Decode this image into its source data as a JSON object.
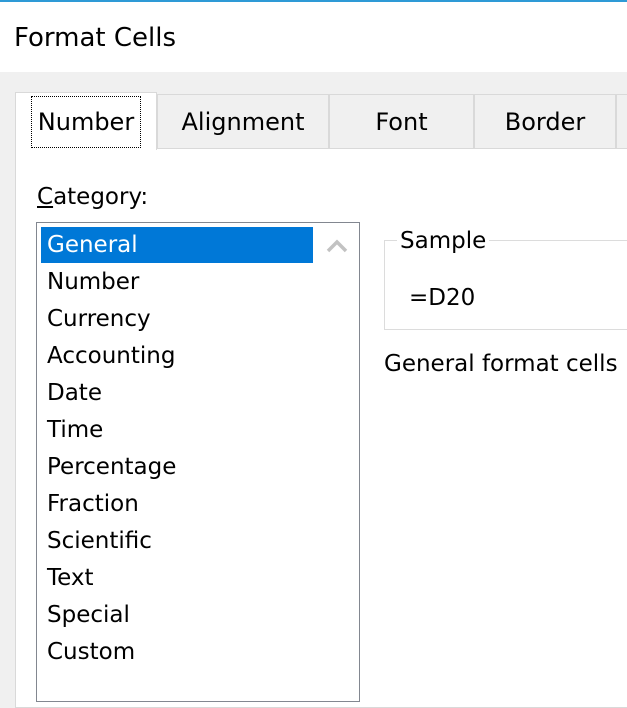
{
  "window": {
    "title": "Format Cells"
  },
  "tabs": [
    {
      "label": "Number",
      "active": true
    },
    {
      "label": "Alignment",
      "active": false
    },
    {
      "label": "Font",
      "active": false
    },
    {
      "label": "Border",
      "active": false
    }
  ],
  "number_tab": {
    "category_label_accel": "C",
    "category_label_rest": "ategory:",
    "categories": [
      {
        "label": "General",
        "selected": true
      },
      {
        "label": "Number",
        "selected": false
      },
      {
        "label": "Currency",
        "selected": false
      },
      {
        "label": "Accounting",
        "selected": false
      },
      {
        "label": "Date",
        "selected": false
      },
      {
        "label": "Time",
        "selected": false
      },
      {
        "label": "Percentage",
        "selected": false
      },
      {
        "label": "Fraction",
        "selected": false
      },
      {
        "label": "Scientific",
        "selected": false
      },
      {
        "label": "Text",
        "selected": false
      },
      {
        "label": "Special",
        "selected": false
      },
      {
        "label": "Custom",
        "selected": false
      }
    ],
    "sample": {
      "legend": "Sample",
      "value": "=D20"
    },
    "description": "General format cells"
  },
  "colors": {
    "accent": "#2e9ad6",
    "selection": "#0078d7",
    "selection_text": "#ffffff"
  },
  "icons": {
    "scroll_up": "chevron-up-icon"
  }
}
